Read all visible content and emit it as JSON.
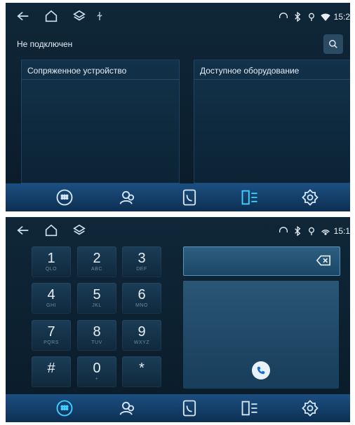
{
  "top_screen": {
    "status": {
      "time": "15:2"
    },
    "connection_status": "Не подключен",
    "panels": {
      "paired": {
        "title": "Сопряженное устройство"
      },
      "available": {
        "title": "Доступное оборудование"
      }
    },
    "dock": {
      "active": "contacts-list"
    }
  },
  "bottom_screen": {
    "status": {
      "time": "15:1"
    },
    "keypad": [
      {
        "digit": "1",
        "letters": "QLO"
      },
      {
        "digit": "2",
        "letters": "ABC"
      },
      {
        "digit": "3",
        "letters": "DEF"
      },
      {
        "digit": "4",
        "letters": "GHI"
      },
      {
        "digit": "5",
        "letters": "JKL"
      },
      {
        "digit": "6",
        "letters": "MNO"
      },
      {
        "digit": "7",
        "letters": "PQRS"
      },
      {
        "digit": "8",
        "letters": "TUV"
      },
      {
        "digit": "9",
        "letters": "WXYZ"
      },
      {
        "digit": "#",
        "letters": ""
      },
      {
        "digit": "0",
        "letters": "+"
      },
      {
        "digit": "*",
        "letters": ""
      }
    ],
    "dial_input": {
      "value": ""
    },
    "dock": {
      "active": "dialpad"
    }
  },
  "colors": {
    "accent": "#41d1ff",
    "background": "#0f2738",
    "dock": "#1b4f82"
  },
  "icons": [
    "back-icon",
    "home-icon",
    "layers-icon",
    "usb-icon",
    "headset-icon",
    "bluetooth-icon",
    "location-icon",
    "wifi-icon",
    "search-icon",
    "dialpad-icon",
    "contacts-icon",
    "phonebook-icon",
    "call-list-icon",
    "settings-icon",
    "backspace-icon",
    "phone-icon"
  ]
}
